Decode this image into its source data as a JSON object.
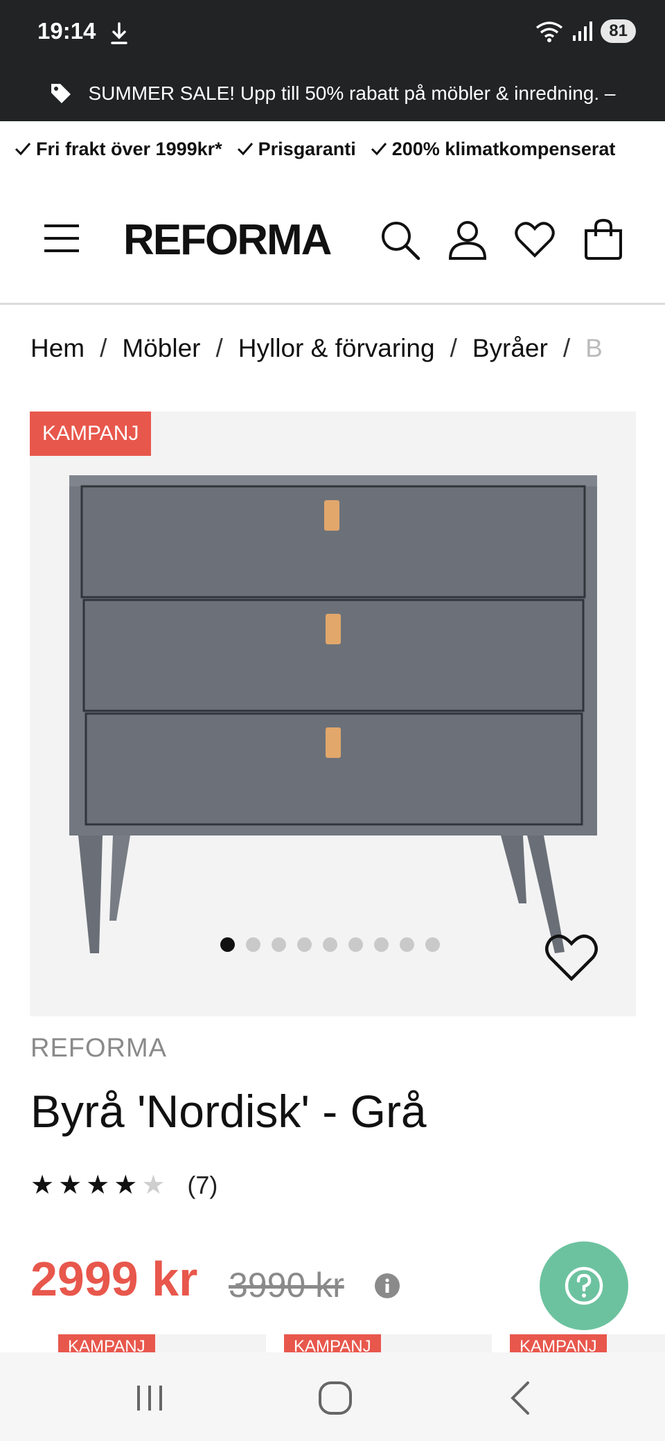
{
  "status_bar": {
    "time": "19:14",
    "battery": "81"
  },
  "promo": {
    "text": "SUMMER SALE! Upp till 50% rabatt på möbler & inredning. –"
  },
  "usp": [
    "Fri frakt över 1999kr*",
    "Prisgaranti",
    "200% klimatkompenserat"
  ],
  "header": {
    "logo": "REFORMA"
  },
  "breadcrumb": {
    "items": [
      "Hem",
      "Möbler",
      "Hyllor & förvaring",
      "Byråer"
    ],
    "truncated": "B"
  },
  "product": {
    "badge": "KAMPANJ",
    "brand": "REFORMA",
    "title": "Byrå 'Nordisk' - Grå",
    "rating": 4,
    "rating_max": 5,
    "review_count": "(7)",
    "price": "2999 kr",
    "old_price": "3990 kr",
    "image_count": 9,
    "active_image": 1
  },
  "recommendations": {
    "badges": [
      "KAMPANJ",
      "KAMPANJ",
      "KAMPANJ"
    ]
  },
  "colors": {
    "accent": "#e8574c",
    "help": "#6cc29f",
    "dark": "#212324"
  }
}
